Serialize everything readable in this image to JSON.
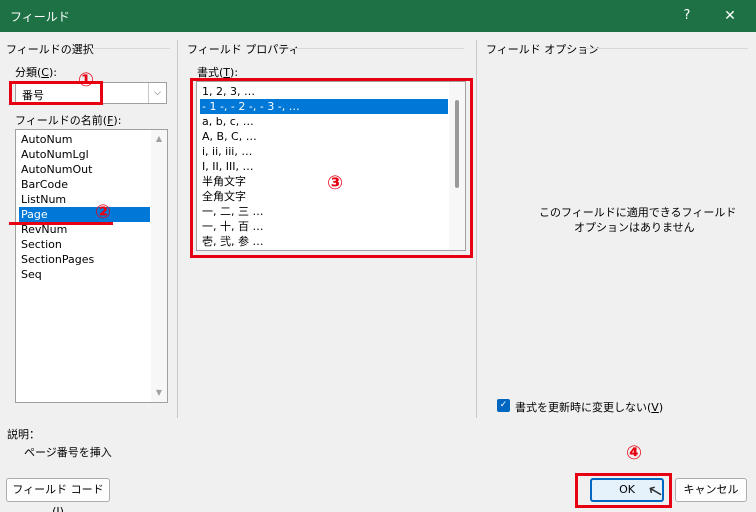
{
  "window": {
    "title": "フィールド",
    "help": "?",
    "close": "✕"
  },
  "field_select": {
    "group_title": "フィールドの選択",
    "category_label": "分類(",
    "category_key": "C",
    "category_suffix": "):",
    "category_value": "番号",
    "names_label": "フィールドの名前(",
    "names_key": "F",
    "names_suffix": "):",
    "items": [
      "AutoNum",
      "AutoNumLgl",
      "AutoNumOut",
      "BarCode",
      "ListNum",
      "Page",
      "RevNum",
      "Section",
      "SectionPages",
      "Seq"
    ],
    "selected_item": "Page"
  },
  "field_properties": {
    "group_title": "フィールド プロパティ",
    "format_label": "書式(",
    "format_key": "T",
    "format_suffix": "):",
    "formats": [
      "1, 2, 3, …",
      "- 1 -, - 2 -, - 3 -, …",
      "a, b, c, …",
      "A, B, C, …",
      "i, ii, iii, …",
      "I, II, III, …",
      "半角文字",
      "全角文字",
      "一, 二, 三 …",
      "一, 十, 百 …",
      "壱, 弐, 参 …"
    ],
    "selected_format": "- 1 -, - 2 -, - 3 -, …"
  },
  "field_options": {
    "group_title": "フィールド オプション",
    "empty_line1": "このフィールドに適用できるフィールド",
    "empty_line2": "オプションはありません",
    "preserve_label": "書式を更新時に変更しない(",
    "preserve_key": "V",
    "preserve_suffix": ")",
    "preserve_checked": true
  },
  "description": {
    "label": "説明：",
    "text": "ページ番号を挿入"
  },
  "buttons": {
    "field_codes_label": "フィールド コード(",
    "field_codes_key": "I",
    "field_codes_suffix": ")",
    "ok": "OK",
    "cancel": "キャンセル"
  },
  "annotations": {
    "m1": "①",
    "m2": "②",
    "m3": "③",
    "m4": "④",
    "color": "#e60012"
  },
  "colors": {
    "titlebar": "#1e7145",
    "selection": "#0078d7",
    "dialog_bg": "#f0f0f0"
  }
}
